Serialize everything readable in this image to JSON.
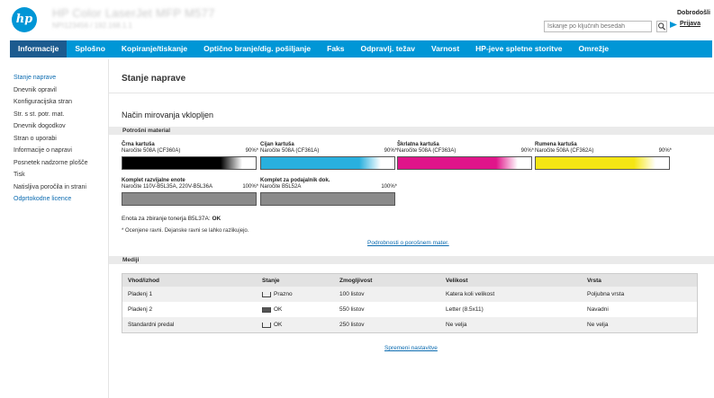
{
  "header": {
    "printer_name": "HP Color LaserJet MFP M577",
    "printer_subtitle": "NPI123456 / 192.168.1.1",
    "search_placeholder": "Iskanje po ključnih besedah",
    "welcome": "Dobrodošli",
    "sign_in": "Prijava"
  },
  "nav": {
    "tabs": [
      "Informacije",
      "Splošno",
      "Kopiranje/tiskanje",
      "Optično branje/dig. pošiljanje",
      "Faks",
      "Odpravlj. težav",
      "Varnost",
      "HP-jeve spletne storitve",
      "Omrežje"
    ],
    "active": 0
  },
  "sidebar": {
    "items": [
      {
        "label": "Stanje naprave",
        "link": true
      },
      {
        "label": "Dnevnik opravil",
        "link": false
      },
      {
        "label": "Konfiguracijska stran",
        "link": false
      },
      {
        "label": "Str. s st. potr. mat.",
        "link": false
      },
      {
        "label": "Dnevnik dogodkov",
        "link": false
      },
      {
        "label": "Stran o uporabi",
        "link": false
      },
      {
        "label": "Informacije o napravi",
        "link": false
      },
      {
        "label": "Posnetek nadzorne plošče",
        "link": false
      },
      {
        "label": "Tisk",
        "link": false
      },
      {
        "label": "Natisljiva poročila in strani",
        "link": false
      },
      {
        "label": "Odprtokodne licence",
        "link": true
      }
    ]
  },
  "main": {
    "title": "Stanje naprave",
    "status": "Način mirovanja vklopljen",
    "supplies_title": "Potrošni material",
    "supplies": [
      {
        "name": "Črna kartuša",
        "order": "Naročite 508A (CF360A)",
        "percent": "90%*",
        "level": 0.9,
        "color": "#000000"
      },
      {
        "name": "Cijan kartuša",
        "order": "Naročite 508A (CF361A)",
        "percent": "90%*",
        "level": 0.9,
        "color": "#29b0de"
      },
      {
        "name": "Škrlatna kartuša",
        "order": "Naročite 508A (CF363A)",
        "percent": "90%*",
        "level": 0.9,
        "color": "#e0158a"
      },
      {
        "name": "Rumena kartuša",
        "order": "Naročite 508A (CF362A)",
        "percent": "90%*",
        "level": 0.9,
        "color": "#f5e614"
      },
      {
        "name": "Komplet razvijalne enote",
        "order": "Naročite 110V-B5L35A, 220V-B5L36A",
        "percent": "100%*",
        "level": 1.0,
        "color": "#8a8a8a"
      },
      {
        "name": "Komplet za podajalnik dok.",
        "order": "Naročite B5L52A",
        "percent": "100%*",
        "level": 1.0,
        "color": "#8a8a8a"
      }
    ],
    "collector_label": "Enota za zbiranje tonerja B5L37A:",
    "collector_value": "OK",
    "note": "* Ocenjene ravni. Dejanske ravni se lahko razlikujejo.",
    "details_link": "Podrobnosti o porošnem mater.",
    "media_title": "Mediji",
    "media_headers": [
      "Vhod/izhod",
      "Stanje",
      "Zmogljivost",
      "Velikost",
      "Vrsta"
    ],
    "media_rows": [
      {
        "tray": "Pladenj 1",
        "state": "Prazno",
        "state_full": false,
        "capacity": "100 listov",
        "size": "Katera koli velikost",
        "type": "Poljubna vrsta"
      },
      {
        "tray": "Pladenj 2",
        "state": "OK",
        "state_full": true,
        "capacity": "550 listov",
        "size": "Letter (8.5x11)",
        "type": "Navadni"
      },
      {
        "tray": "Standardni predal",
        "state": "OK",
        "state_full": false,
        "capacity": "250 listov",
        "size": "Ne velja",
        "type": "Ne velja"
      }
    ],
    "change_link": "Spremeni nastavitve"
  }
}
